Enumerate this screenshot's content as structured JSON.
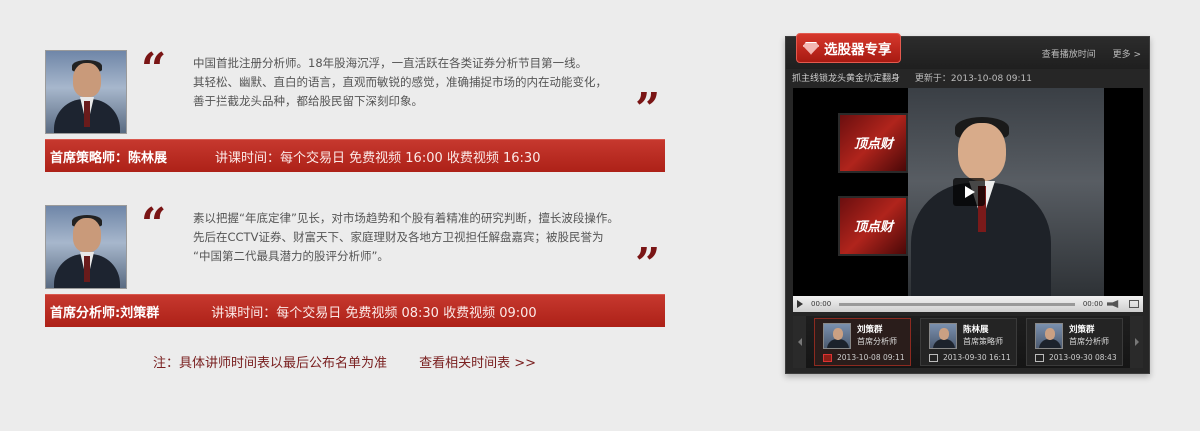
{
  "analysts": [
    {
      "bio": [
        "中国首批注册分析师。18年股海沉浮，一直活跃在各类证券分析节目第一线。",
        "其轻松、幽默、直白的语言，直观而敏锐的感觉，准确捕捉市场的内在动能变化，",
        "善于拦截龙头品种，都给股民留下深刻印象。"
      ],
      "role": "首席策略师：陈林展",
      "schedule": "讲课时间：每个交易日 免费视频 16:00 收费视频 16:30"
    },
    {
      "bio": [
        "素以把握“年底定律”见长，对市场趋势和个股有着精准的研究判断，擅长波段操作。",
        "先后在CCTV证券、财富天下、家庭理财及各地方卫视担任解盘嘉宾；被股民誉为",
        "“中国第二代最具潜力的股评分析师”。"
      ],
      "role": "首席分析师:刘策群",
      "schedule": "讲课时间：每个交易日 免费视频 08:30 收费视频 09:00"
    }
  ],
  "quote_open": "“",
  "quote_close": "”",
  "note": {
    "text": "注：具体讲师时间表以最后公布名单为准",
    "link": "查看相关时间表 >>"
  },
  "player": {
    "brand": "选股器专享",
    "links": [
      "查看播放时间",
      "更多 >"
    ],
    "video_title": "抓主线锁龙头黄金坑定翻身",
    "updated": "更新于：2013-10-08 09:11",
    "screen_logo": "顶点财",
    "time_current": "00:00",
    "time_total": "00:00",
    "thumbs": [
      {
        "name": "刘策群",
        "role": "首席分析师",
        "date": "2013-10-08 09:11"
      },
      {
        "name": "陈林展",
        "role": "首席策略师",
        "date": "2013-09-30 16:11"
      },
      {
        "name": "刘策群",
        "role": "首席分析师",
        "date": "2013-09-30 08:43"
      }
    ]
  },
  "colors": {
    "accent": "#b0241c",
    "background": "#ececec",
    "panel": "#262626"
  },
  "icons": [
    "quote-open-icon",
    "quote-close-icon",
    "gem-icon",
    "play-icon",
    "volume-icon",
    "fullscreen-icon",
    "arrow-left-icon",
    "arrow-right-icon",
    "video-icon"
  ]
}
